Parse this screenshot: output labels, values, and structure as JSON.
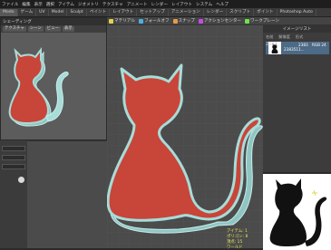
{
  "menubar": {
    "items": [
      "ファイル",
      "編集",
      "表示",
      "選択",
      "アイテム",
      "ジオメトリ",
      "テクスチャ",
      "アニメート",
      "レンダー",
      "レイアウト",
      "システム",
      "ヘルプ"
    ]
  },
  "tabs": {
    "items": [
      "Modo",
      "ゲーム",
      "UV",
      "Model",
      "Sculpt",
      "ペイント",
      "レイアウト",
      "セットアップ",
      "アニメーション",
      "レンダー",
      "スクリプト",
      "ポイント",
      "Photoshop Auto"
    ]
  },
  "toolbar": {
    "tools": [
      {
        "label": "マテリアル",
        "color": "#e5d24a"
      },
      {
        "label": "フォールオフ",
        "color": "#4ab0e5"
      },
      {
        "label": "スナップ",
        "color": "#e59a4a"
      },
      {
        "label": "アクションセンター",
        "color": "#c84ae5"
      },
      {
        "label": "ワークプレーン",
        "color": "#6ae54a"
      }
    ]
  },
  "float_window": {
    "title": "シェーディング",
    "buttons": [
      "テクスチャ",
      "シーン",
      "ビュー",
      "表示"
    ]
  },
  "right_panel": {
    "title": "イメージリスト",
    "columns": [
      "名前",
      "解像度",
      "形式"
    ],
    "row": {
      "name": "2383...",
      "res": "2383",
      "format": "RGB 24",
      "sub": "2383511..."
    }
  },
  "status": {
    "lines": [
      "アイテム: 1",
      "ポリゴン: 8",
      "頂点: 15",
      "ワールド"
    ]
  },
  "colors": {
    "cat_fill": "#c8453a",
    "cat_edge": "#9fd6d2",
    "viewport_bg": "#4b4b4b"
  }
}
